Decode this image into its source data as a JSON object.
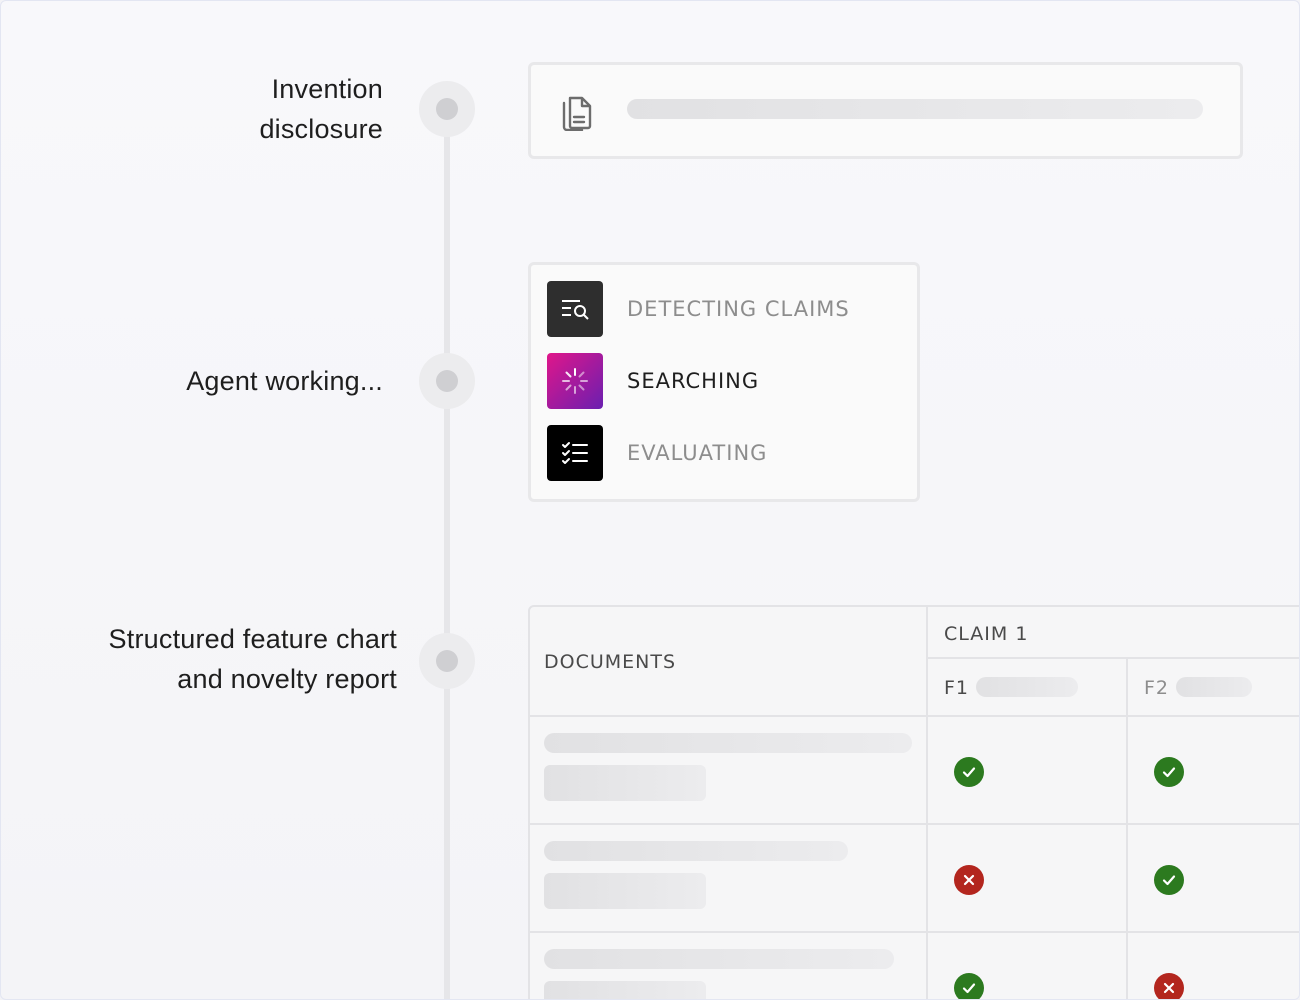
{
  "steps": [
    {
      "label_line1": "Invention",
      "label_line2": "disclosure",
      "icon": "document-icon"
    },
    {
      "label_line1": "Agent working...",
      "label_line2": ""
    },
    {
      "label_line1": "Structured feature chart",
      "label_line2": "and novelty report"
    }
  ],
  "agent_tasks": [
    {
      "label": "DETECTING CLAIMS",
      "icon": "claims-search-icon",
      "state": "done",
      "tile_color": "#2e2e2e",
      "text_color": "#8d8d8d"
    },
    {
      "label": "SEARCHING",
      "icon": "spinner-icon",
      "state": "active",
      "tile_color": "#c0177f",
      "text_color": "#1e1e1e"
    },
    {
      "label": "EVALUATING",
      "icon": "checklist-icon",
      "state": "pending",
      "tile_color": "#000000",
      "text_color": "#8d8d8d"
    }
  ],
  "table": {
    "documents_header": "DOCUMENTS",
    "claim_header": "CLAIM 1",
    "features": [
      "F1",
      "F2"
    ],
    "rows": [
      {
        "results": [
          "match",
          "match"
        ]
      },
      {
        "results": [
          "no-match",
          "match"
        ]
      },
      {
        "results": [
          "match",
          "no-match"
        ]
      }
    ]
  },
  "colors": {
    "match": "#2c7a1f",
    "no_match": "#b3261e",
    "searching_gradient_start": "#e0168a",
    "searching_gradient_end": "#6a1fb0"
  }
}
